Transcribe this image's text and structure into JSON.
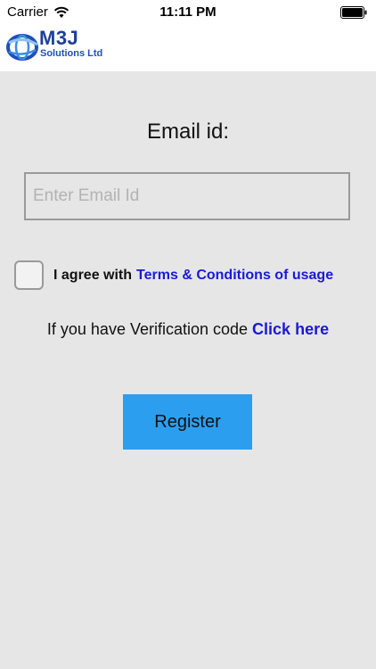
{
  "status_bar": {
    "carrier": "Carrier",
    "time": "11:11 PM",
    "wifi_icon": "wifi-icon",
    "battery_icon": "battery-icon"
  },
  "header": {
    "logo_title": "M3J",
    "logo_subtitle": "Solutions Ltd",
    "brand_color": "#1e3f9a"
  },
  "form": {
    "email_label": "Email id:",
    "email_placeholder": "Enter Email Id",
    "email_value": "",
    "agree_text": "I agree with",
    "terms_link": "Terms & Conditions of usage",
    "terms_checked": false,
    "verify_text": "If you have Verification code",
    "verify_link": "Click here",
    "register_label": "Register"
  },
  "colors": {
    "background": "#e6e6e6",
    "button": "#2c9ef0",
    "link": "#1a1ad6"
  }
}
